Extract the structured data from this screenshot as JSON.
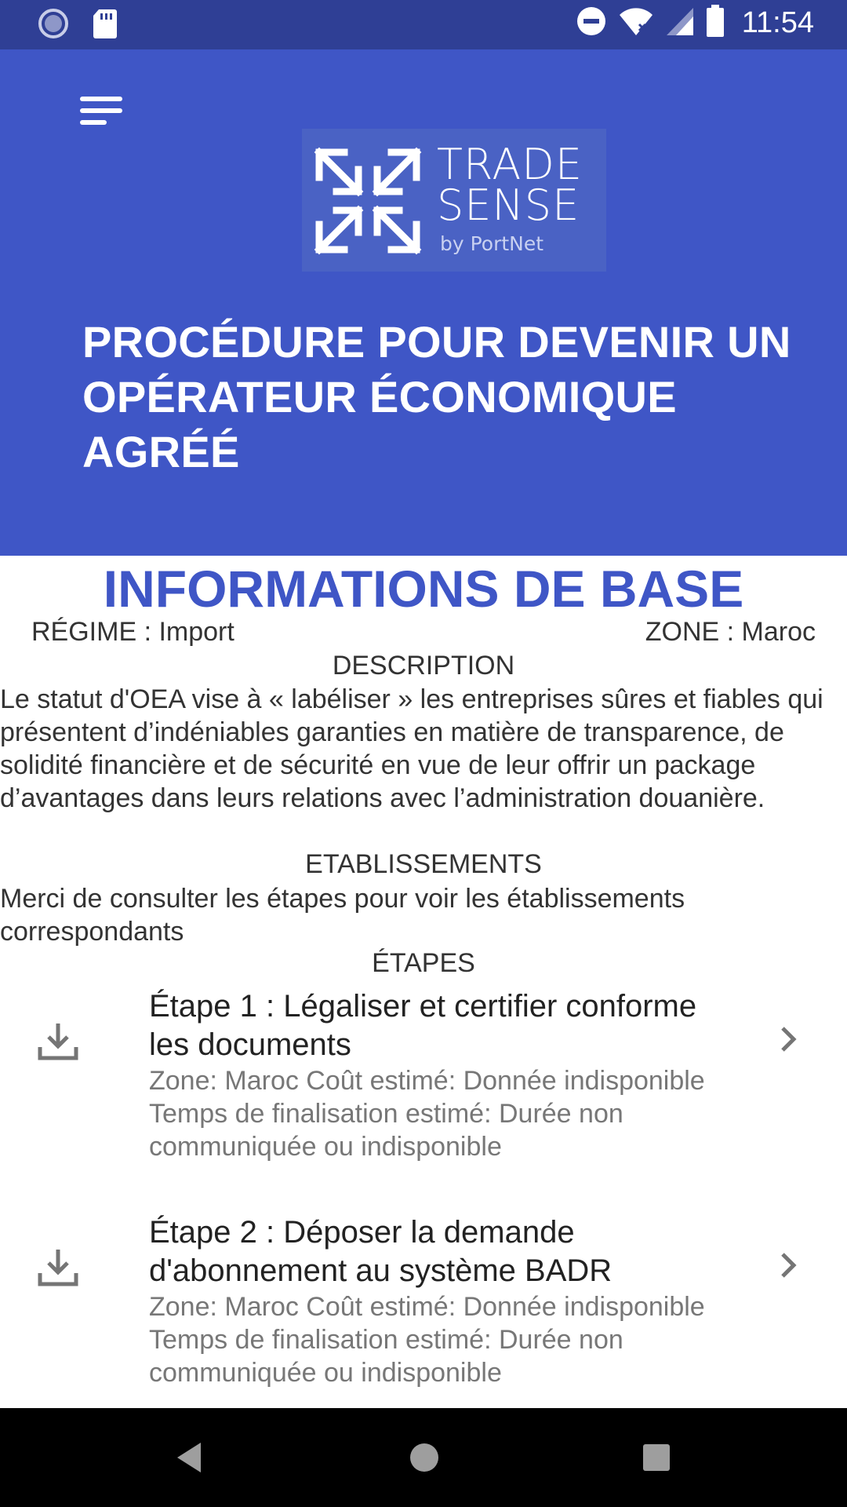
{
  "status_bar": {
    "time": "11:54",
    "icons": [
      "loading-icon",
      "sd-card-icon",
      "do-not-disturb-icon",
      "wifi-icon",
      "signal-icon",
      "battery-icon"
    ]
  },
  "header": {
    "menu_icon": "menu-icon",
    "logo": {
      "word_1": "TRADE",
      "word_2": "SENSE",
      "byline": "by PortNet"
    },
    "title": "PROCÉDURE POUR DEVENIR UN OPÉRATEUR ÉCONOMIQUE AGRÉÉ",
    "background_color": "#3f56c6"
  },
  "info": {
    "section_title": "INFORMATIONS DE BASE",
    "regime": "RÉGIME : Import",
    "zone": "ZONE : Maroc",
    "description_heading": "DESCRIPTION",
    "description": "Le statut d'OEA vise à « labéliser » les entreprises sûres et fiables qui présentent d’indéniables garanties en matière de transparence, de solidité financière et de sécurité en vue de leur offrir un package d’avantages dans leurs relations avec l’administration douanière.",
    "establishments_heading": "ETABLISSEMENTS",
    "establishments_text": "Merci de consulter les étapes pour voir les établissements correspondants",
    "steps_heading": "ÉTAPES"
  },
  "steps": [
    {
      "title": "Étape 1 : Légaliser et certifier conforme les documents",
      "zone_cost": "Zone: Maroc Coût estimé: Donnée indisponible",
      "time": "Temps de finalisation estimé: Durée non communiquée ou indisponible",
      "icon": "download-icon",
      "action_icon": "chevron-right-icon"
    },
    {
      "title": "Étape 2 : Déposer la demande d'abonnement au système BADR",
      "zone_cost": "Zone: Maroc Coût estimé: Donnée indisponible",
      "time": "Temps de finalisation estimé: Durée non communiquée ou indisponible",
      "icon": "download-icon",
      "action_icon": "chevron-right-icon"
    }
  ],
  "nav_bar": {
    "buttons": [
      "back-icon",
      "home-icon",
      "recents-icon"
    ]
  }
}
